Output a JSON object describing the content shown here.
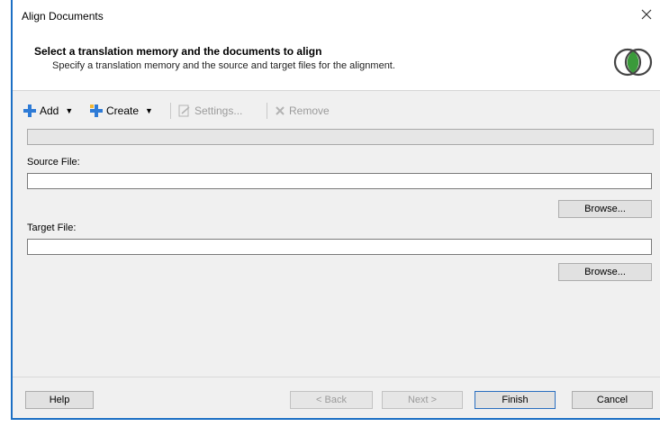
{
  "window": {
    "title": "Align Documents"
  },
  "header": {
    "title": "Select a translation memory and the documents to align",
    "subtitle": "Specify a translation memory and the source and target files for the alignment."
  },
  "toolbar": {
    "add": "Add",
    "create": "Create",
    "settings": "Settings...",
    "remove": "Remove"
  },
  "source": {
    "label": "Source File:",
    "value": "",
    "browse": "Browse..."
  },
  "target": {
    "label": "Target File:",
    "value": "",
    "browse": "Browse..."
  },
  "footer": {
    "help": "Help",
    "back": "< Back",
    "next": "Next >",
    "finish": "Finish",
    "cancel": "Cancel"
  },
  "colors": {
    "accent": "#1c6fc4",
    "logo": "#3a9a3a"
  }
}
